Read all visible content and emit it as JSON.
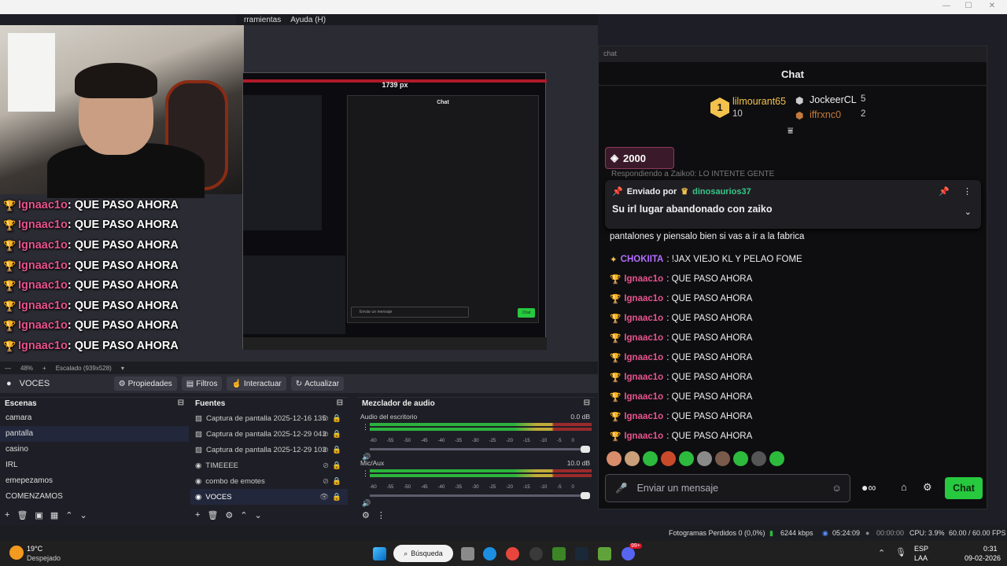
{
  "menu": {
    "tools": "rramientas",
    "help": "Ayuda (H)"
  },
  "nested": {
    "width_label": "1739 px",
    "chat_title": "Chat",
    "input_placeholder": "Enviar un mensaje",
    "chat_btn": "Chat"
  },
  "overlay_chat": [
    {
      "nick": "Ignaac1o",
      "msg": ": QUE PASO AHORA"
    },
    {
      "nick": "Ignaac1o",
      "msg": ": QUE PASO AHORA"
    },
    {
      "nick": "Ignaac1o",
      "msg": ": QUE PASO AHORA"
    },
    {
      "nick": "Ignaac1o",
      "msg": ": QUE PASO AHORA"
    },
    {
      "nick": "Ignaac1o",
      "msg": ": QUE PASO AHORA"
    },
    {
      "nick": "Ignaac1o",
      "msg": ": QUE PASO AHORA"
    },
    {
      "nick": "Ignaac1o",
      "msg": ": QUE PASO AHORA"
    },
    {
      "nick": "Ignaac1o",
      "msg": ": QUE PASO AHORA"
    }
  ],
  "preview_bar": {
    "zoom": "48%",
    "scale": "Escalado (939x528)"
  },
  "controls": {
    "source_name": "VOCES",
    "properties": "Propiedades",
    "filters": "Filtros",
    "interact": "Interactuar",
    "refresh": "Actualizar"
  },
  "scenes": {
    "title": "Escenas",
    "items": [
      "camara",
      "pantalla",
      "casino",
      "IRL",
      "emepezamos",
      "COMENZAMOS"
    ],
    "selected": 1
  },
  "sources": {
    "title": "Fuentes",
    "items": [
      "Captura de pantalla 2025-12-16 135",
      "Captura de pantalla 2025-12-29 043",
      "Captura de pantalla 2025-12-29 103",
      "TIMEEEE",
      "combo de emotes",
      "VOCES"
    ],
    "selected": 5
  },
  "mixer": {
    "title": "Mezclador de audio",
    "channels": [
      {
        "name": "Audio del escritorio",
        "db": "0.0 dB"
      },
      {
        "name": "Mic/Aux",
        "db": "10.0 dB"
      }
    ],
    "ticks": [
      "-60",
      "-55",
      "-50",
      "-45",
      "-40",
      "-35",
      "-30",
      "-25",
      "-20",
      "-15",
      "-10",
      "-5",
      "0"
    ]
  },
  "chat": {
    "window_title": "chat",
    "title": "Chat",
    "leaders": [
      {
        "name": "lilmourant65",
        "count": "10",
        "rank": "1"
      },
      {
        "name": "JockeerCL",
        "count": "5"
      },
      {
        "name": "iffrxnc0",
        "count": "2"
      }
    ],
    "goal": "2000",
    "reply_hint": "Respondiendo a Zaiko0: LO INTENTE GENTE",
    "pinned": {
      "label": "Enviado por",
      "user": "dinosaurios37",
      "text": "Su irl lugar abandonado con zaiko"
    },
    "partial_line": "pantalones y piensalo bien si vas a ir a la fabrica",
    "messages": [
      {
        "nick": "CHOKIITA",
        "msg": ": !JAX VIEJO KL Y PELAO FOME",
        "style": "n1"
      },
      {
        "nick": "Ignaac1o",
        "msg": ": QUE PASO AHORA",
        "style": "n2"
      },
      {
        "nick": "Ignaac1o",
        "msg": ": QUE PASO AHORA",
        "style": "n2"
      },
      {
        "nick": "Ignaac1o",
        "msg": ": QUE PASO AHORA",
        "style": "n2"
      },
      {
        "nick": "Ignaac1o",
        "msg": ": QUE PASO AHORA",
        "style": "n2"
      },
      {
        "nick": "Ignaac1o",
        "msg": ": QUE PASO AHORA",
        "style": "n2"
      },
      {
        "nick": "Ignaac1o",
        "msg": ": QUE PASO AHORA",
        "style": "n2"
      },
      {
        "nick": "Ignaac1o",
        "msg": ": QUE PASO AHORA",
        "style": "n2"
      },
      {
        "nick": "Ignaac1o",
        "msg": ": QUE PASO AHORA",
        "style": "n2"
      },
      {
        "nick": "Ignaac1o",
        "msg": ": QUE PASO AHORA",
        "style": "n2"
      }
    ],
    "input_placeholder": "Enviar un mensaje",
    "send_label": "Chat"
  },
  "status": {
    "dropped": "Fotogramas Perdidos 0 (0,0%)",
    "kbps": "6244 kbps",
    "live": "05:24:09",
    "rec": "00:00:00",
    "cpu": "CPU: 3.9%",
    "fps": "60.00 / 60.00 FPS"
  },
  "taskbar": {
    "temp": "19°C",
    "weather": "Despejado",
    "search": "Búsqueda",
    "lang": "ESP",
    "layout": "LAA",
    "time": "0:31",
    "date": "09-02-2026",
    "badge": "99+"
  },
  "colors": {
    "accent_green": "#27c93f",
    "nick_pink": "#e8548f",
    "nick_purple": "#b46eff",
    "badge_gold": "#f3c24d"
  }
}
